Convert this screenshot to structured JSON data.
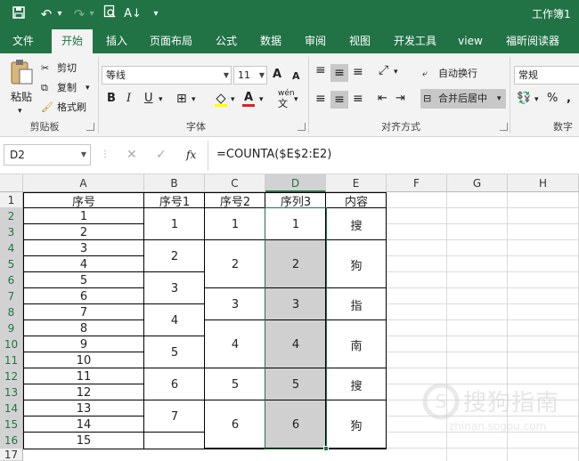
{
  "title_bar": {
    "workbook_title": "工作簿1",
    "undo_dropdown": "▾",
    "redo_dropdown": "▾",
    "customize": "▾"
  },
  "tabs": [
    "文件",
    "开始",
    "插入",
    "页面布局",
    "公式",
    "数据",
    "审阅",
    "视图",
    "开发工具",
    "view",
    "福昕阅读器"
  ],
  "ribbon": {
    "clipboard": {
      "paste": "粘贴",
      "cut": "剪切",
      "copy": "复制",
      "format_painter": "格式刷",
      "label": "剪贴板"
    },
    "font": {
      "name": "等线",
      "size": "11",
      "grow": "A",
      "shrink": "A",
      "bold": "B",
      "italic": "I",
      "underline": "U",
      "phonetic": "wén",
      "label": "字体"
    },
    "alignment": {
      "wrap": "自动换行",
      "merge": "合并后居中",
      "label": "对齐方式"
    },
    "number": {
      "format": "常规",
      "percent": "%",
      "comma": ",",
      "label": "数字"
    }
  },
  "formula_bar": {
    "name_box": "D2",
    "fx": "fx",
    "formula": "=COUNTA($E$2:E2)"
  },
  "sheet": {
    "columns": [
      "A",
      "B",
      "C",
      "D",
      "E",
      "F",
      "G",
      "H"
    ],
    "rows": [
      "1",
      "2",
      "3",
      "4",
      "5",
      "6",
      "7",
      "8",
      "9",
      "10",
      "11",
      "12",
      "13",
      "14",
      "15",
      "16",
      "17"
    ],
    "headers": {
      "A": "序号",
      "B": "序号1",
      "C": "序号2",
      "D": "序列3",
      "E": "内容"
    },
    "col_a": [
      "1",
      "2",
      "3",
      "4",
      "5",
      "6",
      "7",
      "8",
      "9",
      "10",
      "11",
      "12",
      "13",
      "14",
      "15"
    ],
    "col_b": [
      "1",
      "2",
      "3",
      "4",
      "5",
      "6",
      "7"
    ],
    "col_c": [
      "1",
      "2",
      "3",
      "4",
      "5",
      "6"
    ],
    "col_d": [
      "1",
      "2",
      "3",
      "4",
      "5",
      "6"
    ],
    "col_e": [
      "搜",
      "狗",
      "指",
      "南",
      "搜",
      "狗"
    ]
  },
  "watermark": {
    "brand": "搜狗指南",
    "url": "zhinan.sogou.com"
  },
  "colors": {
    "excel_green": "#217346",
    "selection_fill": "#d0d0d0",
    "selection_border": "#217346"
  }
}
